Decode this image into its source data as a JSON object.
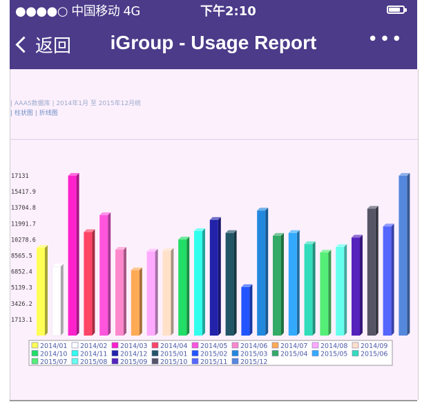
{
  "status_bar": {
    "carrier": "●●●●○ 中国移动 4G",
    "time": "下午2:10"
  },
  "nav": {
    "back_label": "返回",
    "title": "iGroup - Usage Report",
    "more_label": "•••"
  },
  "report": {
    "subtitle": "| AAAS数据库 | 2014年1月 至 2015年12月统",
    "chart_links": [
      "柱状图",
      "折线图"
    ]
  },
  "chart_data": {
    "type": "bar",
    "title": "",
    "xlabel": "",
    "ylabel": "",
    "yticks": [
      "1713.1",
      "3426.2",
      "5139.3",
      "6852.4",
      "8565.5",
      "10278.6",
      "11991.7",
      "13704.8",
      "15417.9",
      "17131"
    ],
    "ylim": [
      0,
      17131
    ],
    "legend_position": "bottom",
    "series": [
      {
        "name": "2014/01",
        "value": 9400,
        "color": "#ffff55"
      },
      {
        "name": "2014/02",
        "value": 7400,
        "color": "#ffffff"
      },
      {
        "name": "2014/03",
        "value": 17131,
        "color": "#ff22cc"
      },
      {
        "name": "2014/04",
        "value": 11100,
        "color": "#ff4466"
      },
      {
        "name": "2014/05",
        "value": 12900,
        "color": "#ff55dd"
      },
      {
        "name": "2014/06",
        "value": 9200,
        "color": "#ff88cc"
      },
      {
        "name": "2014/07",
        "value": 7000,
        "color": "#ffaa55"
      },
      {
        "name": "2014/08",
        "value": 9000,
        "color": "#ffaaff"
      },
      {
        "name": "2014/09",
        "value": 9100,
        "color": "#ffe0c8"
      },
      {
        "name": "2014/10",
        "value": 10300,
        "color": "#22dd66"
      },
      {
        "name": "2014/11",
        "value": 11200,
        "color": "#33ffee"
      },
      {
        "name": "2014/12",
        "value": 12400,
        "color": "#2222aa"
      },
      {
        "name": "2015/01",
        "value": 11000,
        "color": "#225566"
      },
      {
        "name": "2015/02",
        "value": 5200,
        "color": "#2255ff"
      },
      {
        "name": "2015/03",
        "value": 13400,
        "color": "#2288dd"
      },
      {
        "name": "2015/04",
        "value": 10700,
        "color": "#33aa66"
      },
      {
        "name": "2015/05",
        "value": 11000,
        "color": "#33aaff"
      },
      {
        "name": "2015/06",
        "value": 9800,
        "color": "#33ddbb"
      },
      {
        "name": "2015/07",
        "value": 8900,
        "color": "#55ee77"
      },
      {
        "name": "2015/08",
        "value": 9500,
        "color": "#66ffee"
      },
      {
        "name": "2015/09",
        "value": 10500,
        "color": "#5522bb"
      },
      {
        "name": "2015/10",
        "value": 13600,
        "color": "#555566"
      },
      {
        "name": "2015/11",
        "value": 11700,
        "color": "#5566ff"
      },
      {
        "name": "2015/12",
        "value": 17131,
        "color": "#5588dd"
      }
    ]
  }
}
